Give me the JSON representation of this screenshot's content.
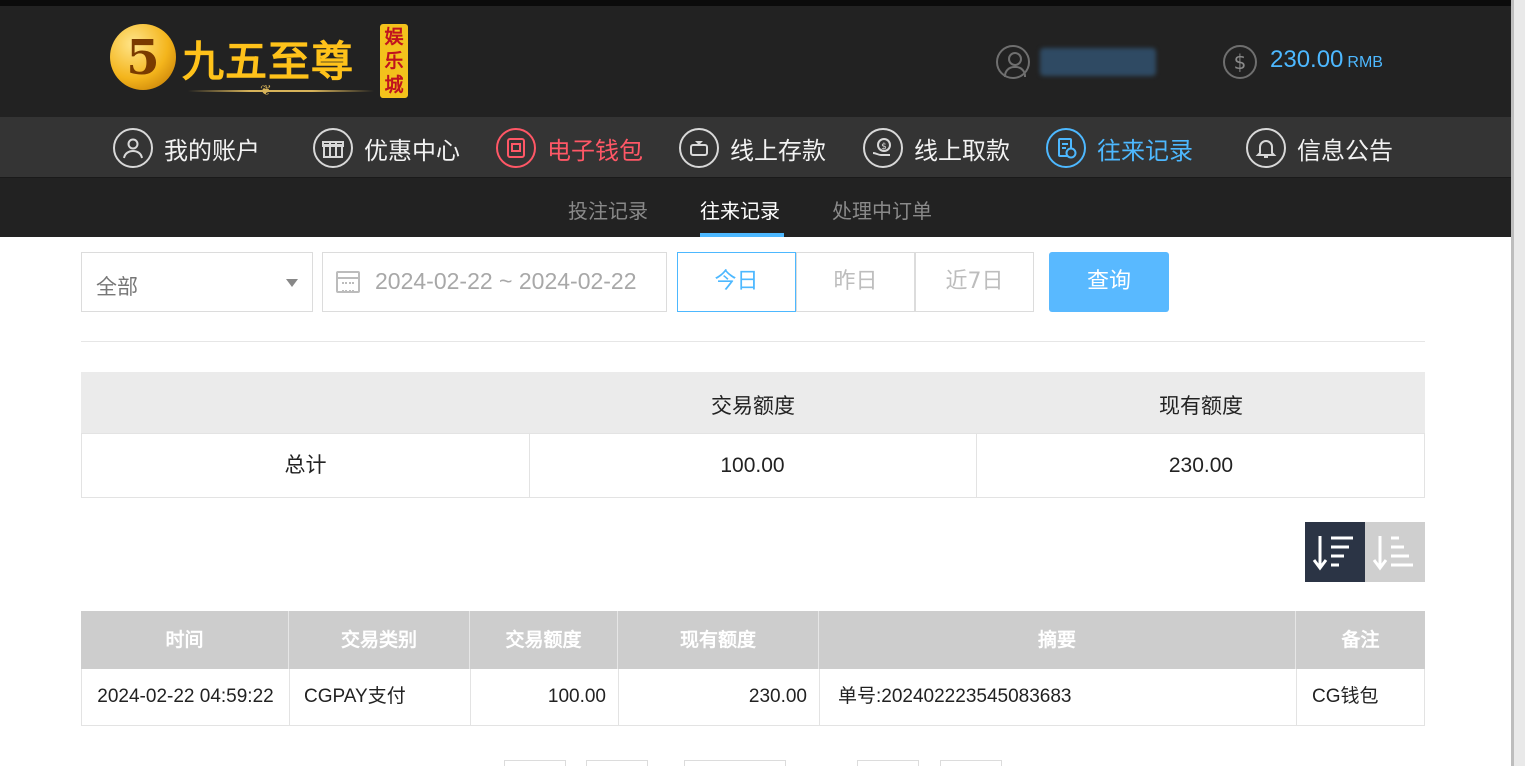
{
  "header": {
    "logo_number": "5",
    "logo_text": "九五至尊",
    "logo_sub": "娱乐城",
    "username": "user",
    "balance": "230.00",
    "currency": "RMB"
  },
  "nav": [
    {
      "label": "我的账户",
      "icon": "user-circle-icon"
    },
    {
      "label": "优惠中心",
      "icon": "gift-icon"
    },
    {
      "label": "电子钱包",
      "icon": "wallet-icon"
    },
    {
      "label": "线上存款",
      "icon": "deposit-icon"
    },
    {
      "label": "线上取款",
      "icon": "withdraw-icon"
    },
    {
      "label": "往来记录",
      "icon": "records-icon"
    },
    {
      "label": "信息公告",
      "icon": "bell-icon"
    }
  ],
  "nav_colors": {
    "active": "#4db8ff",
    "highlight": "#ff5766",
    "default": "#f2f2f2"
  },
  "subnav": {
    "bet_records": "投注记录",
    "transaction_records": "往来记录",
    "pending_orders": "处理中订单"
  },
  "filters": {
    "type_value": "全部",
    "date_range": "2024-02-22 ~ 2024-02-22",
    "today": "今日",
    "yesterday": "昨日",
    "last7": "近7日",
    "search": "查询"
  },
  "summary": {
    "headers": [
      "",
      "交易额度",
      "现有额度"
    ],
    "total_label": "总计",
    "total_amount": "100.00",
    "current_amount": "230.00"
  },
  "records": {
    "headers": [
      "时间",
      "交易类别",
      "交易额度",
      "现有额度",
      "摘要",
      "备注"
    ],
    "rows": [
      {
        "time": "2024-02-22 04:59:22",
        "type": "CGPAY支付",
        "amount": "100.00",
        "balance": "230.00",
        "summary": "单号:202402223545083683",
        "note": "CG钱包"
      }
    ]
  }
}
